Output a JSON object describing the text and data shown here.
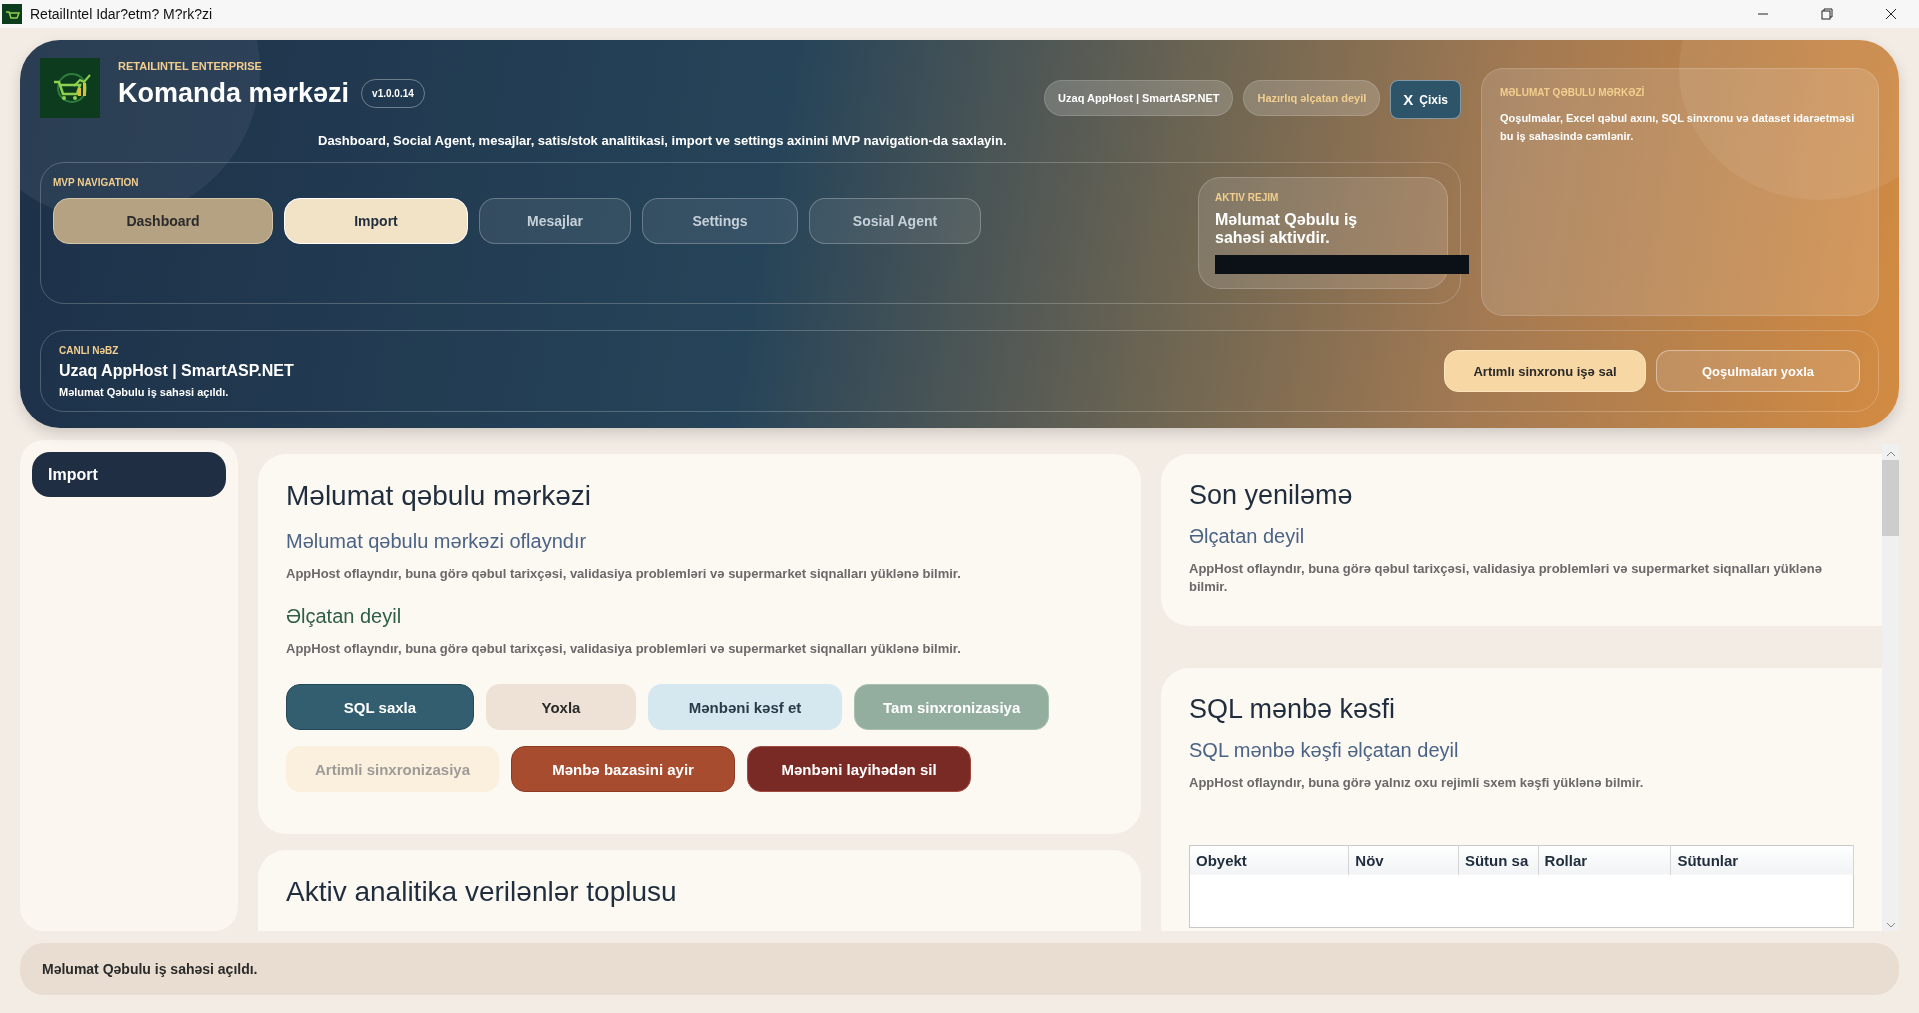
{
  "title_bar": {
    "title": "RetailIntel Idar?etm? M?rk?zi"
  },
  "header": {
    "brand": "RETAILINTEL ENTERPRISE",
    "title": "Komanda mərkəzi",
    "version": "v1.0.0.14",
    "subtitle": "Dashboard, Social Agent, mesajlar, satis/stok analitikasi, import ve settings axinini MVP navigation-da saxlayin.",
    "status_pills": [
      {
        "label": "Uzaq AppHost | SmartASP.NET",
        "kind": "host"
      },
      {
        "label": "Hazırlıq əlçatan deyil",
        "kind": "warning"
      }
    ],
    "logout": {
      "icon": "X",
      "label": "Çixis"
    },
    "nav": {
      "label": "MVP NAVIGATION",
      "items": [
        {
          "label": "Dashboard",
          "selected": false,
          "highlighted": true
        },
        {
          "label": "Import",
          "selected": true,
          "highlighted": false
        },
        {
          "label": "Mesajlar",
          "selected": false,
          "highlighted": false
        },
        {
          "label": "Settings",
          "selected": false,
          "highlighted": false
        },
        {
          "label": "Sosial Agent",
          "selected": false,
          "highlighted": false
        }
      ]
    },
    "active_mode": {
      "label": "AKTIV REJIM",
      "text": "Məlumat Qəbulu iş sahəsi aktivdir."
    },
    "info_card": {
      "label": "MƏLUMAT QƏBULU MƏRKƏZİ",
      "text": "Qoşulmalar, Excel qəbul axını, SQL sinxronu və dataset idarəetməsi bu iş sahəsində cəmlənir."
    },
    "live_pulse": {
      "label": "CANLI NəBZ",
      "title": "Uzaq AppHost | SmartASP.NET",
      "text": "Məlumat Qəbulu iş sahəsi açıldı.",
      "buttons": [
        {
          "label": "Artımlı sinxronu işə sal",
          "kind": "primary"
        },
        {
          "label": "Qoşulmaları yoxla",
          "kind": "outline"
        }
      ]
    }
  },
  "sidebar": {
    "items": [
      {
        "label": "Import",
        "selected": true
      }
    ]
  },
  "ingest_card": {
    "title": "Məlumat qəbulu mərkəzi",
    "sections": [
      {
        "heading": "Məlumat qəbulu mərkəzi oflayndır",
        "kind": "info",
        "text": "AppHost oflayndır, buna görə qəbul tarixçəsi, validasiya problemləri və supermarket siqnalları yüklənə bilmir."
      },
      {
        "heading": "Əlçatan deyil",
        "kind": "success",
        "text": "AppHost oflayndır, buna görə qəbul tarixçəsi, validasiya problemləri və supermarket siqnalları yüklənə bilmir."
      }
    ],
    "buttons": [
      {
        "label": "SQL saxla",
        "kind": "primary",
        "disabled": false
      },
      {
        "label": "Yoxla",
        "kind": "neutral",
        "disabled": false
      },
      {
        "label": "Mənbəni kəsf et",
        "kind": "info",
        "disabled": false
      },
      {
        "label": "Tam sinxronizasiya",
        "kind": "success",
        "disabled": false
      },
      {
        "label": "Artimli sinxronizasiya",
        "kind": "warning",
        "disabled": true
      },
      {
        "label": "Mənbə bazasini ayir",
        "kind": "danger",
        "disabled": false
      },
      {
        "label": "Mənbəni layihədən sil",
        "kind": "critical",
        "disabled": false
      }
    ]
  },
  "next_card": {
    "title": "Aktiv analitika verilənlər toplusu"
  },
  "last_update": {
    "title": "Son yeniləmə",
    "heading": "Əlçatan deyil",
    "text": "AppHost oflayndır, buna görə qəbul tarixçəsi, validasiya problemləri və supermarket siqnalları yüklənə bilmir."
  },
  "sql_discovery": {
    "title": "SQL mənbə kəsfi",
    "heading": "SQL mənbə kəşfi əlçatan deyil",
    "text": "AppHost oflayndır, buna görə yalnız oxu rejimli sxem kəşfi yüklənə bilmir.",
    "table": {
      "columns": [
        "Obyekt",
        "Növ",
        "Sütun sa",
        "Rollar",
        "Sütunlar"
      ]
    }
  },
  "status_bar": {
    "text": "Məlumat Qəbulu iş sahəsi açıldı."
  }
}
